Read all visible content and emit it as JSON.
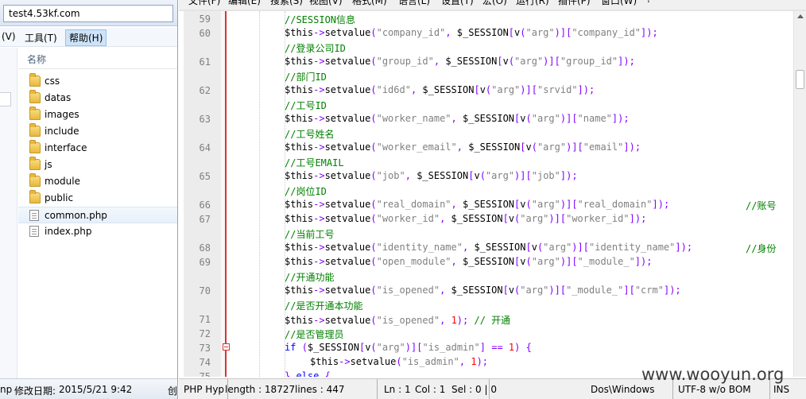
{
  "explorer": {
    "address": "test4.53kf.com",
    "menu": [
      "(V)",
      "工具(T)",
      "帮助(H)"
    ],
    "column_header": "名称",
    "items": [
      {
        "name": "css",
        "type": "folder-icon"
      },
      {
        "name": "datas",
        "type": "folder-icon"
      },
      {
        "name": "images",
        "type": "folder-icon"
      },
      {
        "name": "include",
        "type": "folder-icon"
      },
      {
        "name": "interface",
        "type": "folder-icon"
      },
      {
        "name": "js",
        "type": "folder-icon"
      },
      {
        "name": "module",
        "type": "folder-icon"
      },
      {
        "name": "public",
        "type": "folder-icon"
      },
      {
        "name": "common.php",
        "type": "php-file-icon",
        "selected": true
      },
      {
        "name": "index.php",
        "type": "php-file-icon"
      }
    ],
    "status": {
      "type": "np",
      "modified_label": "修改日期:",
      "modified_value": "2015/5/21 9:42",
      "extra": "创"
    }
  },
  "editor": {
    "menu": [
      "文件(F)",
      "编辑(E)",
      "搜索(S)",
      "视图(V)",
      "格式(M)",
      "语言(L)",
      "设置(T)",
      "宏(O)",
      "运行(R)",
      "插件(P)",
      "窗口(W)",
      "?"
    ],
    "lines": [
      {
        "n": "59",
        "t": "//SESSION信息"
      },
      {
        "n": "60",
        "t": "$this->setvalue(\"company_id\", $_SESSION[v(\"arg\")][\"company_id\"]);"
      },
      {
        "n": "",
        "t": "//登录公司ID"
      },
      {
        "n": "61",
        "t": "$this->setvalue(\"group_id\", $_SESSION[v(\"arg\")][\"group_id\"]);"
      },
      {
        "n": "",
        "t": "//部门ID"
      },
      {
        "n": "62",
        "t": "$this->setvalue(\"id6d\", $_SESSION[v(\"arg\")][\"srvid\"]);"
      },
      {
        "n": "",
        "t": "//工号ID"
      },
      {
        "n": "63",
        "t": "$this->setvalue(\"worker_name\", $_SESSION[v(\"arg\")][\"name\"]);"
      },
      {
        "n": "",
        "t": "//工号姓名"
      },
      {
        "n": "64",
        "t": "$this->setvalue(\"worker_email\", $_SESSION[v(\"arg\")][\"email\"]);"
      },
      {
        "n": "",
        "t": "//工号EMAIL"
      },
      {
        "n": "65",
        "t": "$this->setvalue(\"job\", $_SESSION[v(\"arg\")][\"job\"]);"
      },
      {
        "n": "",
        "t": "//岗位ID"
      },
      {
        "n": "66",
        "t": "$this->setvalue(\"real_domain\", $_SESSION[v(\"arg\")][\"real_domain\"]);",
        "tail": "//账号"
      },
      {
        "n": "67",
        "t": "$this->setvalue(\"worker_id\", $_SESSION[v(\"arg\")][\"worker_id\"]);"
      },
      {
        "n": "",
        "t": "//当前工号"
      },
      {
        "n": "68",
        "t": "$this->setvalue(\"identity_name\", $_SESSION[v(\"arg\")][\"identity_name\"]);",
        "tail": "//身份"
      },
      {
        "n": "69",
        "t": "$this->setvalue(\"open_module\", $_SESSION[v(\"arg\")][\"_module_\"]);"
      },
      {
        "n": "",
        "t": "//开通功能"
      },
      {
        "n": "70",
        "t": "$this->setvalue(\"is_opened\", $_SESSION[v(\"arg\")][\"_module_\"][\"crm\"]);"
      },
      {
        "n": "",
        "t": "//是否开通本功能"
      },
      {
        "n": "71",
        "t": "$this->setvalue(\"is_opened\", 1); // 开通"
      },
      {
        "n": "72",
        "t": "//是否管理员"
      },
      {
        "n": "73",
        "t": "if ($_SESSION[v(\"arg\")][\"is_admin\"] == 1) {"
      },
      {
        "n": "74",
        "t": "$this->setvalue(\"is_admin\", 1);",
        "deep": true
      },
      {
        "n": "75",
        "t": "} else {"
      }
    ],
    "status": {
      "lang": "PHP Hyp",
      "length": "length : 18727",
      "lines": "lines : 447",
      "ln": "Ln : 1",
      "col": "Col : 1",
      "sel": "Sel : 0 | 0",
      "eol": "Dos\\Windows",
      "encoding": "UTF-8 w/o BOM",
      "mode": "INS"
    }
  },
  "watermark": "www.wooyun.org",
  "colors": {
    "comment": "#008000",
    "string": "#808080",
    "operator": "#8000ff",
    "number": "#ff0000",
    "keyword": "#0000ff",
    "fold_marker": "#d43535"
  }
}
